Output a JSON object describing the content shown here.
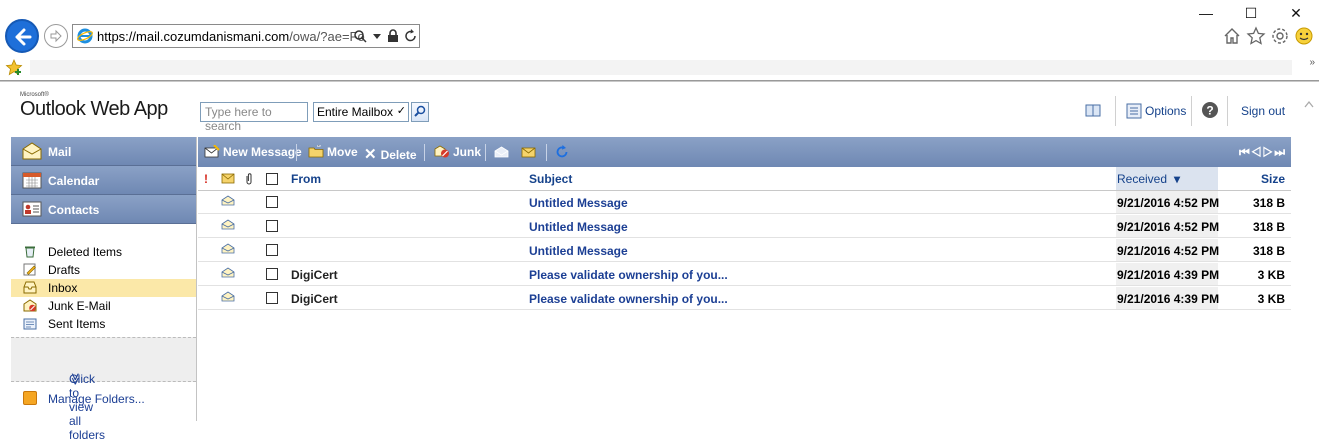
{
  "browser": {
    "url_host": "https://mail.cozumdanismani.com",
    "url_path": "/owa/?ae=Fo"
  },
  "header": {
    "brand_small": "Microsoft®",
    "brand_app": "Outlook Web App",
    "search_placeholder": "Type here to search",
    "search_scope": "Entire Mailbox",
    "options_label": "Options",
    "signout_label": "Sign out"
  },
  "nav": {
    "modules": [
      {
        "label": "Mail"
      },
      {
        "label": "Calendar"
      },
      {
        "label": "Contacts"
      }
    ],
    "folders": [
      {
        "label": "Deleted Items"
      },
      {
        "label": "Drafts"
      },
      {
        "label": "Inbox"
      },
      {
        "label": "Junk E-Mail"
      },
      {
        "label": "Sent Items"
      }
    ],
    "view_all_label": "Click to view all folders",
    "view_all_glyph": "≫",
    "manage_label": "Manage Folders..."
  },
  "toolbar": {
    "new_message": "New Message",
    "move": "Move",
    "delete": "Delete",
    "junk": "Junk",
    "pager_glyphs": "⏮◁▷⏭"
  },
  "columns": {
    "importance": "!",
    "from": "From",
    "subject": "Subject",
    "received": "Received",
    "sort_glyph": "▾",
    "size": "Size"
  },
  "messages": [
    {
      "from": "",
      "subject": "Untitled Message",
      "received": "9/21/2016 4:52 PM",
      "size": "318 B"
    },
    {
      "from": "",
      "subject": "Untitled Message",
      "received": "9/21/2016 4:52 PM",
      "size": "318 B"
    },
    {
      "from": "",
      "subject": "Untitled Message",
      "received": "9/21/2016 4:52 PM",
      "size": "318 B"
    },
    {
      "from": "DigiCert",
      "subject": "Please validate ownership of you...",
      "received": "9/21/2016 4:39 PM",
      "size": "3 KB"
    },
    {
      "from": "DigiCert",
      "subject": "Please validate ownership of you...",
      "received": "9/21/2016 4:39 PM",
      "size": "3 KB"
    }
  ],
  "colors": {
    "bar": "#7a92bc",
    "link": "#1c3f94",
    "selected_folder": "#fbe8a8"
  }
}
